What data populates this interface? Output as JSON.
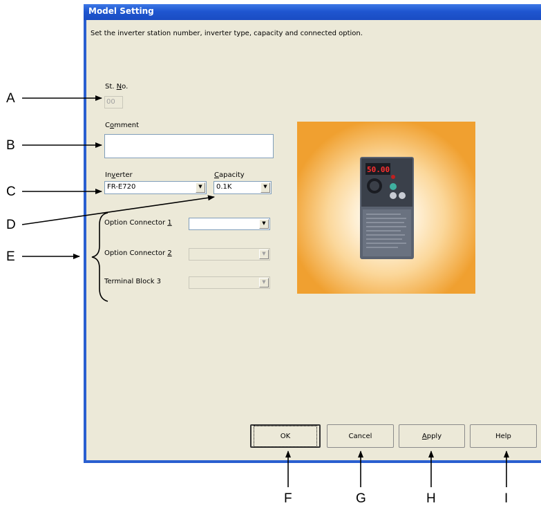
{
  "window": {
    "title": "Model Setting",
    "instruction": "Set the inverter station number, inverter type, capacity and connected option."
  },
  "station": {
    "label_pre": "St. ",
    "label_key": "N",
    "label_post": "o.",
    "value": "00"
  },
  "comment": {
    "label_pre": "C",
    "label_key": "o",
    "label_post": "mment",
    "value": ""
  },
  "inverter": {
    "label_pre": "In",
    "label_key": "v",
    "label_post": "erter",
    "value": "FR-E720"
  },
  "capacity": {
    "label_pre": "",
    "label_key": "C",
    "label_post": "apacity",
    "value": "0.1K"
  },
  "options": [
    {
      "label_pre": "Option Connector ",
      "label_key": "1",
      "value": ""
    },
    {
      "label_pre": "Option Connector ",
      "label_key": "2",
      "value": ""
    },
    {
      "label_pre": "Terminal Block 3",
      "label_key": "",
      "value": ""
    }
  ],
  "buttons": {
    "ok": "OK",
    "cancel": "Cancel",
    "apply_key": "A",
    "apply_rest": "pply",
    "help": "Help"
  },
  "device_display": "50.00",
  "callouts": {
    "a": "A",
    "b": "B",
    "c": "C",
    "d": "D",
    "e": "E",
    "f": "F",
    "g": "G",
    "h": "H",
    "i": "I"
  },
  "colors": {
    "titlebar": "#1f56d0",
    "dialog_bg": "#ece9d8",
    "image_bg": "#f0a030"
  }
}
